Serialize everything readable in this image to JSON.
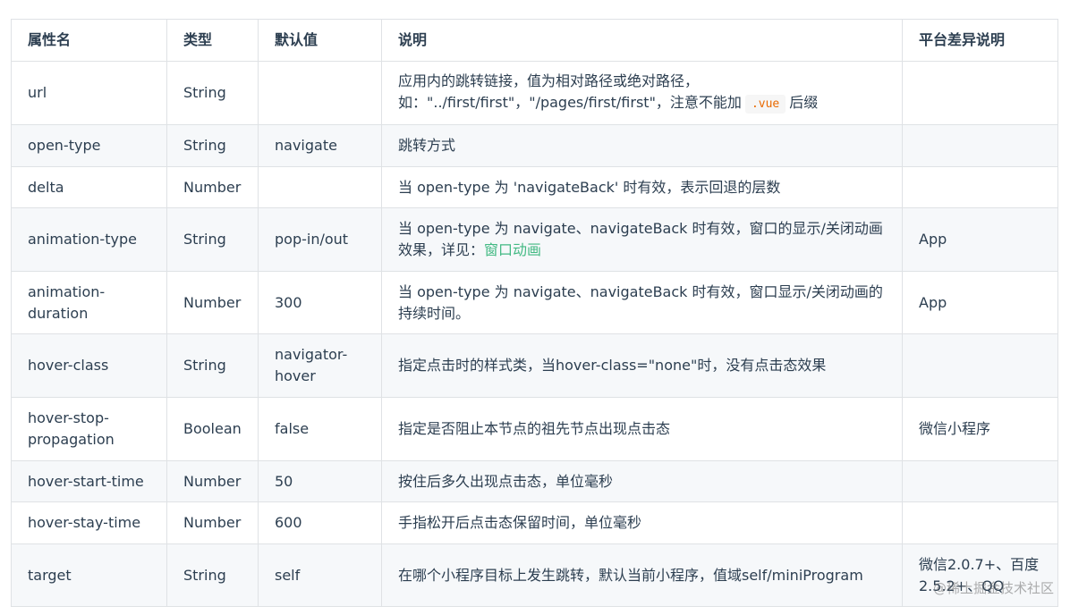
{
  "table": {
    "headers": [
      "属性名",
      "类型",
      "默认值",
      "说明",
      "平台差异说明"
    ],
    "rows": [
      {
        "name": "url",
        "type": "String",
        "default": "",
        "desc_line1": "应用内的跳转链接，值为相对路径或绝对路径，",
        "desc_line2_pre": "如：\"../first/first\"，\"/pages/first/first\"，注意不能加",
        "desc_code": ".vue",
        "desc_line2_post": "后缀",
        "platform": ""
      },
      {
        "name": "open-type",
        "type": "String",
        "default": "navigate",
        "desc": "跳转方式",
        "platform": ""
      },
      {
        "name": "delta",
        "type": "Number",
        "default": "",
        "desc": "当 open-type 为 'navigateBack' 时有效，表示回退的层数",
        "platform": ""
      },
      {
        "name": "animation-type",
        "type": "String",
        "default": "pop-in/out",
        "desc_pre": "当 open-type 为 navigate、navigateBack 时有效，窗口的显示/关闭动画效果，详见：",
        "desc_link": "窗口动画",
        "platform": "App"
      },
      {
        "name": "animation-duration",
        "type": "Number",
        "default": "300",
        "desc": "当 open-type 为 navigate、navigateBack 时有效，窗口显示/关闭动画的持续时间。",
        "platform": "App"
      },
      {
        "name": "hover-class",
        "type": "String",
        "default": "navigator-hover",
        "desc": "指定点击时的样式类，当hover-class=\"none\"时，没有点击态效果",
        "platform": ""
      },
      {
        "name": "hover-stop-propagation",
        "type": "Boolean",
        "default": "false",
        "desc": "指定是否阻止本节点的祖先节点出现点击态",
        "platform": "微信小程序"
      },
      {
        "name": "hover-start-time",
        "type": "Number",
        "default": "50",
        "desc": "按住后多久出现点击态，单位毫秒",
        "platform": ""
      },
      {
        "name": "hover-stay-time",
        "type": "Number",
        "default": "600",
        "desc": "手指松开后点击态保留时间，单位毫秒",
        "platform": ""
      },
      {
        "name": "target",
        "type": "String",
        "default": "self",
        "desc": "在哪个小程序目标上发生跳转，默认当前小程序，值域self/miniProgram",
        "platform": "微信2.0.7+、百度2.5.2+、QQ"
      }
    ]
  },
  "watermark": "@稀土掘金技术社区"
}
